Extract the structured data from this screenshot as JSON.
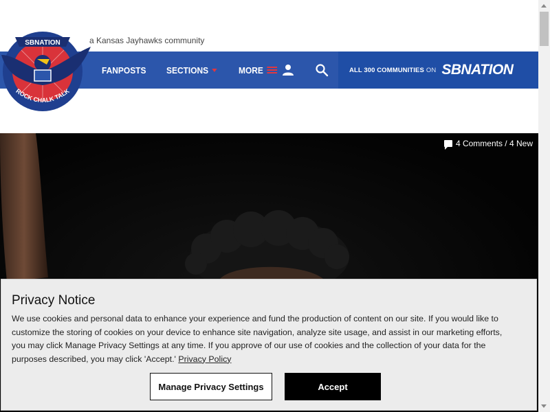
{
  "header": {
    "tagline": "a Kansas Jayhawks community",
    "logo": {
      "icon": "rock-chalk-talk-logo",
      "top_text": "SBNATION",
      "bottom_text": "ROCK CHALK TALK"
    },
    "nav": [
      {
        "label": "FANPOSTS"
      },
      {
        "label": "SECTIONS",
        "icon": "caret-down-icon"
      },
      {
        "label": "MORE",
        "icon": "hamburger-icon"
      }
    ],
    "icons": {
      "user": "user-icon",
      "search": "search-icon"
    },
    "communities": {
      "prefix": "ALL 300 COMMUNITIES",
      "on": "ON",
      "brand": "SBNATION"
    }
  },
  "hero": {
    "comments": "4 Comments / 4 New"
  },
  "privacy": {
    "title": "Privacy Notice",
    "body": "We use cookies and personal data to enhance your experience and fund the production of content on our site. If you would like to customize the storing of cookies on your device to enhance site navigation, analyze site usage, and assist in our marketing efforts, you may click Manage Privacy Settings at any time. If you approve of our use of cookies and the collection of your data for the purposes described, you may click 'Accept.'",
    "link": "Privacy Policy",
    "manage_label": "Manage Privacy Settings",
    "accept_label": "Accept"
  },
  "colors": {
    "nav_bg": "#2c56ab",
    "communities_bg": "#1f4ea6",
    "accent_red": "#e2373f"
  }
}
